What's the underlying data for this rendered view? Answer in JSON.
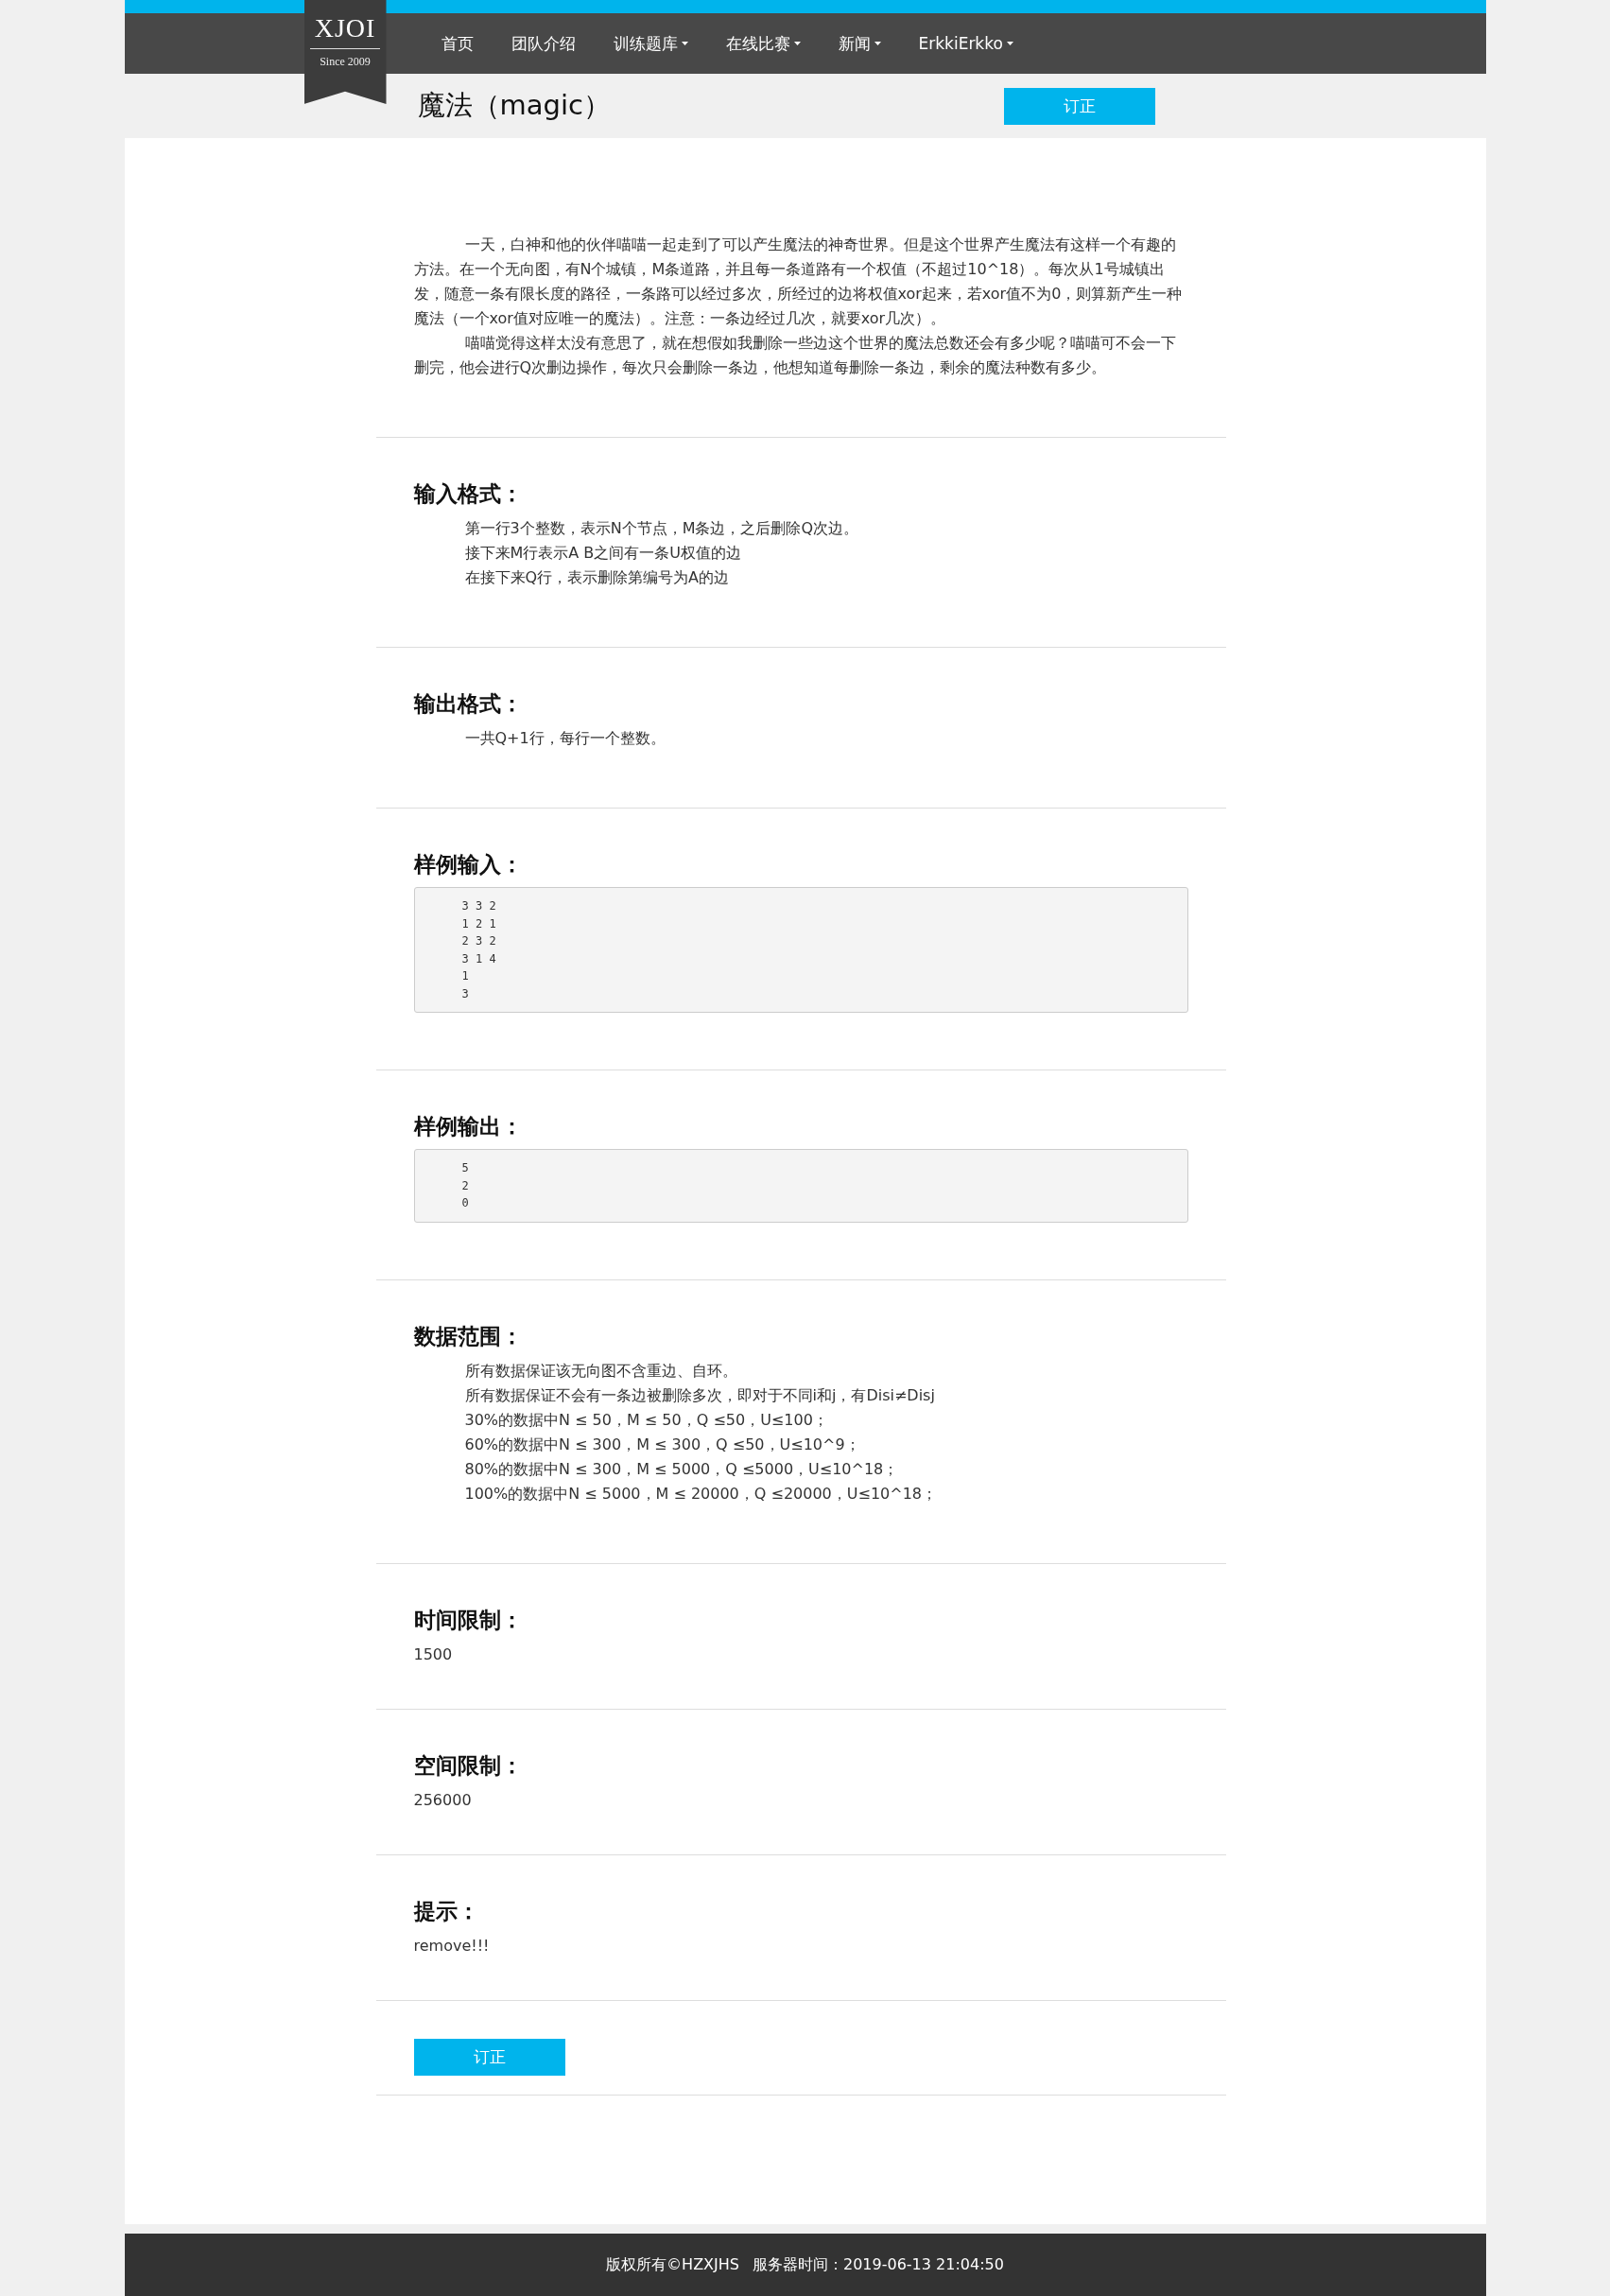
{
  "logo": {
    "name": "XJOI",
    "since": "Since 2009"
  },
  "nav": [
    {
      "label": "首页",
      "dropdown": false
    },
    {
      "label": "团队介绍",
      "dropdown": false
    },
    {
      "label": "训练题库",
      "dropdown": true
    },
    {
      "label": "在线比赛",
      "dropdown": true
    },
    {
      "label": "新闻",
      "dropdown": true
    },
    {
      "label": "ErkkiErkko",
      "dropdown": true
    }
  ],
  "problem": {
    "title": "魔法（magic）",
    "action": "订正"
  },
  "statement": [
    "一天，白神和他的伙伴喵喵一起走到了可以产生魔法的神奇世界。但是这个世界产生魔法有这样一个有趣的方法。在一个无向图，有N个城镇，M条道路，并且每一条道路有一个权值（不超过10^18）。每次从1号城镇出发，随意一条有限长度的路径，一条路可以经过多次，所经过的边将权值xor起来，若xor值不为0，则算新产生一种魔法（一个xor值对应唯一的魔法）。注意：一条边经过几次，就要xor几次）。",
    "喵喵觉得这样太没有意思了，就在想假如我删除一些边这个世界的魔法总数还会有多少呢？喵喵可不会一下删完，他会进行Q次删边操作，每次只会删除一条边，他想知道每删除一条边，剩余的魔法种数有多少。"
  ],
  "sections": [
    {
      "kind": "text",
      "heading": "输入格式：",
      "lines": [
        "第一行3个整数，表示N个节点，M条边，之后删除Q次边。",
        "接下来M行表示A B之间有一条U权值的边",
        "在接下来Q行，表示删除第编号为A的边"
      ]
    },
    {
      "kind": "text",
      "heading": "输出格式：",
      "lines": [
        "一共Q+1行，每行一个整数。"
      ]
    },
    {
      "kind": "code",
      "heading": "样例输入：",
      "lines": [
        "3 3 2",
        "1 2 1",
        "2 3 2",
        "3 1 4",
        "1",
        "3"
      ]
    },
    {
      "kind": "code",
      "heading": "样例输出：",
      "lines": [
        "5",
        "2",
        "0"
      ]
    },
    {
      "kind": "text",
      "heading": "数据范围：",
      "lines": [
        "所有数据保证该无向图不含重边、自环。",
        "所有数据保证不会有一条边被删除多次，即对于不同i和j，有Disi≠Disj",
        "30%的数据中N ≤ 50，M ≤ 50，Q ≤50，U≤100；",
        "60%的数据中N ≤ 300，M ≤ 300，Q ≤50，U≤10^9；",
        "80%的数据中N ≤ 300，M ≤ 5000，Q ≤5000，U≤10^18；",
        "100%的数据中N ≤ 5000，M ≤ 20000，Q ≤20000，U≤10^18；"
      ]
    },
    {
      "kind": "value",
      "heading": "时间限制：",
      "lines": [
        "1500"
      ]
    },
    {
      "kind": "value",
      "heading": "空间限制：",
      "lines": [
        "256000"
      ]
    },
    {
      "kind": "value",
      "heading": "提示：",
      "lines": [
        "remove!!!"
      ]
    }
  ],
  "bottom_action": "订正",
  "footer": {
    "copyright": "版权所有©HZXJHS",
    "server_time": "服务器时间：2019-06-13 21:04:50"
  }
}
